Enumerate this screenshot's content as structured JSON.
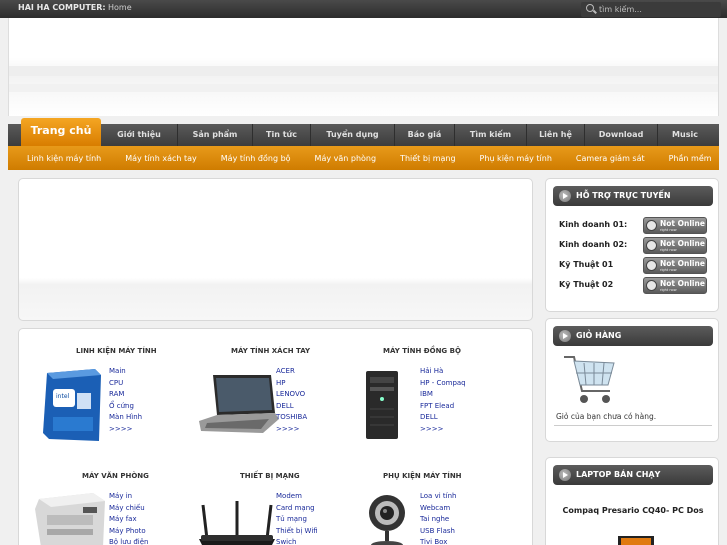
{
  "topbar": {
    "brand": "HAI HA COMPUTER:",
    "home_link": "Home",
    "search_placeholder": "tìm kiếm...",
    "search_icon": "search-icon"
  },
  "main_nav": [
    {
      "label": "Trang chủ",
      "active": true
    },
    {
      "label": "Giới thiệu"
    },
    {
      "label": "Sản phẩm"
    },
    {
      "label": "Tin tức"
    },
    {
      "label": "Tuyển dụng"
    },
    {
      "label": "Báo giá"
    },
    {
      "label": "Tìm kiếm"
    },
    {
      "label": "Liên hệ"
    },
    {
      "label": "Download"
    },
    {
      "label": "Music"
    }
  ],
  "sub_nav": [
    "Linh kiện máy tính",
    "Máy tính xách tay",
    "Máy tính đồng bộ",
    "Máy văn phòng",
    "Thiết bị mạng",
    "Phụ kiện máy tính",
    "Camera giám sát",
    "Phần mềm"
  ],
  "categories": [
    {
      "title": "LINH KIỆN MÁY TÍNH",
      "image": "cpu-box-image",
      "links": [
        "Main",
        "CPU",
        "RAM",
        "Ổ cứng",
        "Màn Hình",
        ">>>>"
      ]
    },
    {
      "title": "MÁY TÍNH XÁCH TAY",
      "image": "laptop-image",
      "links": [
        "ACER",
        "HP",
        "LENOVO",
        "DELL",
        "TOSHIBA",
        ">>>>"
      ]
    },
    {
      "title": "MÁY TÍNH ĐỒNG BỘ",
      "image": "desktop-tower-image",
      "links": [
        "Hải Hà",
        "HP - Compaq",
        "IBM",
        "FPT Elead",
        "DELL",
        ">>>>"
      ]
    },
    {
      "title": "MÁY VĂN PHÒNG",
      "image": "printer-image",
      "links": [
        "Máy in",
        "Máy chiếu",
        "Máy fax",
        "Máy Photo",
        "Bộ lưu điện"
      ]
    },
    {
      "title": "THIẾT BỊ MẠNG",
      "image": "router-image",
      "links": [
        "Modem",
        "Card mạng",
        "Tủ mạng",
        "Thiết bị Wifi",
        "Swich"
      ]
    },
    {
      "title": "PHỤ KIỆN MÁY TÍNH",
      "image": "webcam-image",
      "links": [
        "Loa vi tính",
        "Webcam",
        "Tai nghe",
        "USB Flash",
        "Tivi Box"
      ]
    }
  ],
  "sidebar": {
    "support": {
      "title": "HỖ TRỢ TRỰC TUYẾN",
      "rows": [
        {
          "label": "Kinh doanh 01:",
          "status": "Not Online",
          "status_sub": "right now"
        },
        {
          "label": "Kinh doanh 02:",
          "status": "Not Online",
          "status_sub": "right now"
        },
        {
          "label": "Kỹ Thuật 01",
          "status": "Not Online",
          "status_sub": "right now"
        },
        {
          "label": "Kỹ Thuật 02",
          "status": "Not Online",
          "status_sub": "right now"
        }
      ]
    },
    "cart": {
      "title": "GIỎ HÀNG",
      "empty_text": "Giỏ của bạn chưa có hàng."
    },
    "bestseller": {
      "title": "LAPTOP BÁN CHẠY",
      "product_name": "Compaq Presario CQ40- PC Dos"
    }
  },
  "colors": {
    "accent_orange": "#e08a0c",
    "dark_bar": "#3c3c3c",
    "link_blue": "#1a2a9a"
  }
}
